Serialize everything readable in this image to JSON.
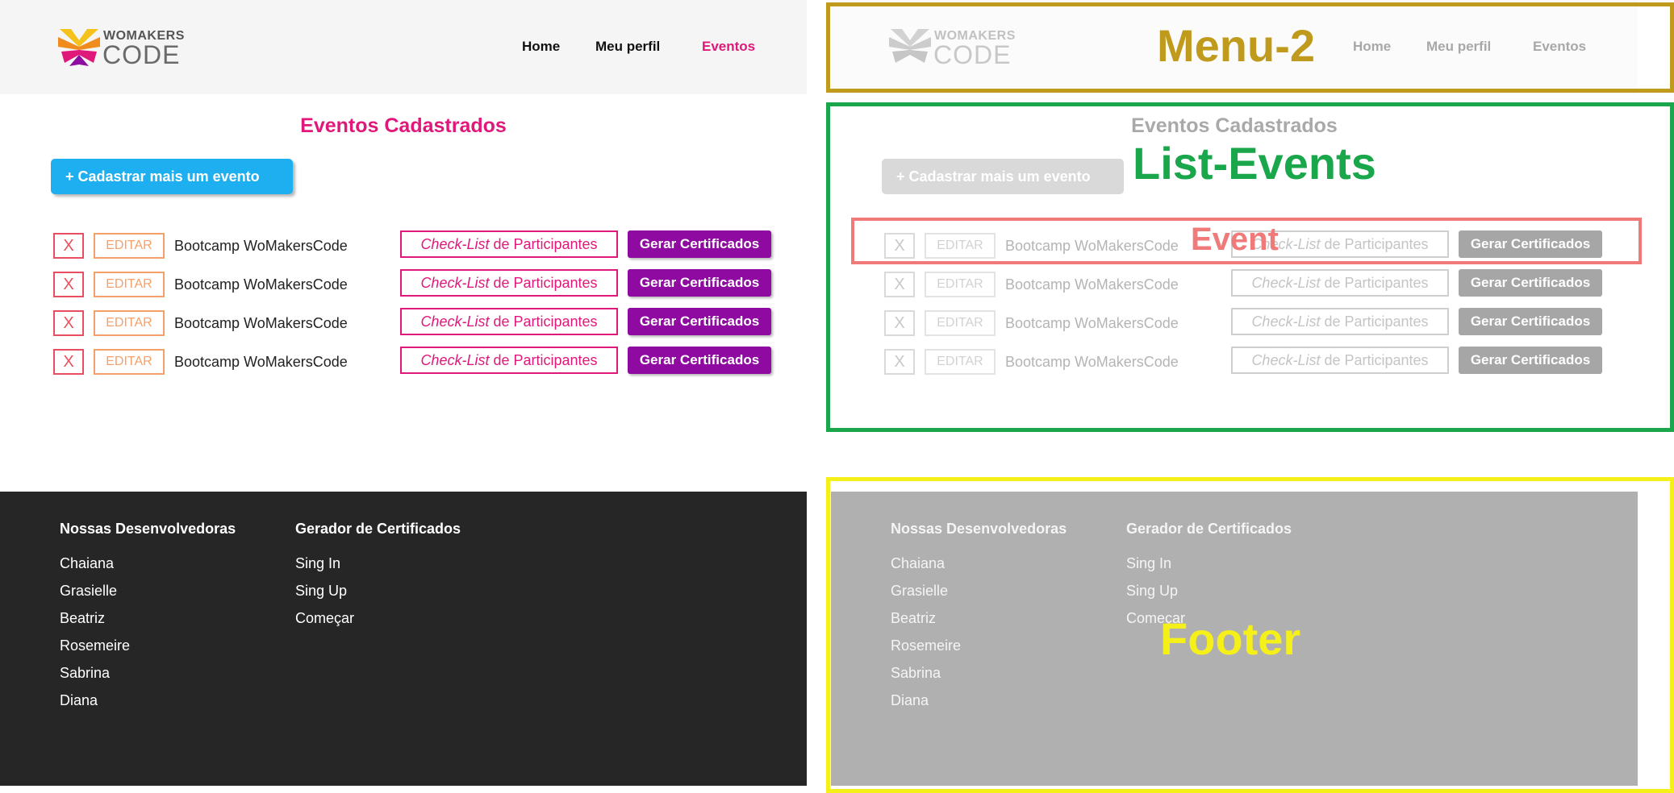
{
  "menu": {
    "logo_top": "WOMAKERS",
    "logo_bottom": "CODE",
    "nav": [
      "Home",
      "Meu perfil",
      "Eventos"
    ]
  },
  "list": {
    "title": "Eventos Cadastrados",
    "add_button": "+ Cadastrar mais um evento",
    "events": [
      {
        "delete": "X",
        "edit": "EDITAR",
        "name": "Bootcamp WoMakersCode",
        "check_italic": "Check-List",
        "check_rest": " de Participantes",
        "generate": "Gerar Certificados"
      },
      {
        "delete": "X",
        "edit": "EDITAR",
        "name": "Bootcamp WoMakersCode",
        "check_italic": "Check-List",
        "check_rest": " de Participantes",
        "generate": "Gerar Certificados"
      },
      {
        "delete": "X",
        "edit": "EDITAR",
        "name": "Bootcamp WoMakersCode",
        "check_italic": "Check-List",
        "check_rest": " de Participantes",
        "generate": "Gerar Certificados"
      },
      {
        "delete": "X",
        "edit": "EDITAR",
        "name": "Bootcamp WoMakersCode",
        "check_italic": "Check-List",
        "check_rest": " de Participantes",
        "generate": "Gerar Certificados"
      }
    ]
  },
  "footer": {
    "col1_title": "Nossas Desenvolvedoras",
    "col1_links": [
      "Chaiana",
      "Grasielle",
      "Beatriz",
      "Rosemeire",
      "Sabrina",
      "Diana"
    ],
    "col2_title": "Gerador de Certificados",
    "col2_links": [
      "Sing In",
      "Sing Up",
      "Começar"
    ]
  },
  "annotations": {
    "menu": {
      "label": "Menu-2",
      "color": "#c09a1c"
    },
    "list": {
      "label": "List-Events",
      "color": "#1aa64b"
    },
    "event": {
      "label": "Event",
      "color": "#f07a7a"
    },
    "footer": {
      "label": "Footer",
      "color": "#f6f01a"
    }
  }
}
